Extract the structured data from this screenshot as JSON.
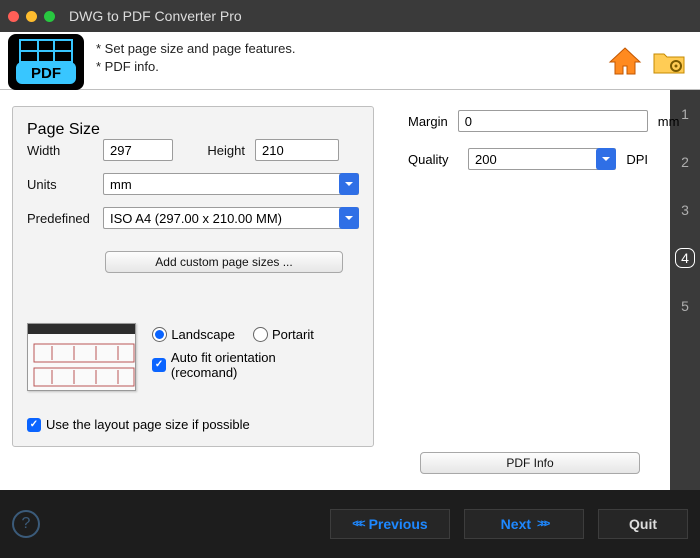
{
  "title": "DWG to PDF Converter Pro",
  "hints": {
    "line1": "* Set page size and page features.",
    "line2": "* PDF info."
  },
  "page_size": {
    "legend": "Page Size",
    "width_label": "Width",
    "width_value": "297",
    "height_label": "Height",
    "height_value": "210",
    "units_label": "Units",
    "units_value": "mm",
    "predefined_label": "Predefined",
    "predefined_value": "ISO A4 (297.00 x 210.00 MM)",
    "add_btn": "Add custom page sizes ...",
    "landscape_label": "Landscape",
    "portrait_label": "Portarit",
    "autofit_label": "Auto fit orientation (recomand)",
    "layout_label": "Use the layout page size if possible"
  },
  "right": {
    "margin_label": "Margin",
    "margin_value": "0",
    "margin_unit": "mm",
    "quality_label": "Quality",
    "quality_value": "200",
    "quality_unit": "DPI",
    "pdf_info_btn": "PDF Info"
  },
  "steps": {
    "s1": "1",
    "s2": "2",
    "s3": "3",
    "s4": "4",
    "s5": "5",
    "current": 4
  },
  "footer": {
    "previous": "Previous",
    "next": "Next",
    "quit": "Quit"
  },
  "icons": {
    "home": "home-icon",
    "folder": "folder-settings-icon",
    "pdf": "pdf-logo"
  }
}
